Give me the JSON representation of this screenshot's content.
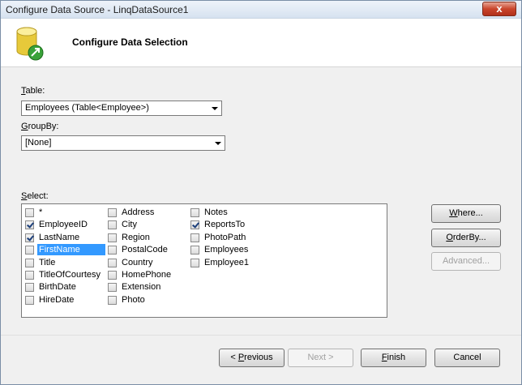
{
  "window": {
    "title": "Configure Data Source - LinqDataSource1",
    "close_label": "x"
  },
  "header": {
    "title": "Configure Data Selection",
    "icon": "database-wizard-icon"
  },
  "table": {
    "label_accel": "T",
    "label_rest": "able:",
    "value": "Employees (Table<Employee>)"
  },
  "groupby": {
    "label_accel": "G",
    "label_rest": "roupBy:",
    "value": "[None]"
  },
  "select": {
    "label_accel": "S",
    "label_rest": "elect:"
  },
  "fields": {
    "col1": [
      {
        "label": "*",
        "checked": false
      },
      {
        "label": "EmployeeID",
        "checked": true
      },
      {
        "label": "LastName",
        "checked": true
      },
      {
        "label": "FirstName",
        "checked": false,
        "selected": true
      },
      {
        "label": "Title",
        "checked": false
      },
      {
        "label": "TitleOfCourtesy",
        "checked": false
      },
      {
        "label": "BirthDate",
        "checked": false
      },
      {
        "label": "HireDate",
        "checked": false
      }
    ],
    "col2": [
      {
        "label": "Address",
        "checked": false
      },
      {
        "label": "City",
        "checked": false
      },
      {
        "label": "Region",
        "checked": false
      },
      {
        "label": "PostalCode",
        "checked": false
      },
      {
        "label": "Country",
        "checked": false
      },
      {
        "label": "HomePhone",
        "checked": false
      },
      {
        "label": "Extension",
        "checked": false
      },
      {
        "label": "Photo",
        "checked": false
      }
    ],
    "col3": [
      {
        "label": "Notes",
        "checked": false
      },
      {
        "label": "ReportsTo",
        "checked": true
      },
      {
        "label": "PhotoPath",
        "checked": false
      },
      {
        "label": "Employees",
        "checked": false
      },
      {
        "label": "Employee1",
        "checked": false
      }
    ]
  },
  "side_buttons": {
    "where_accel": "W",
    "where_rest": "here...",
    "orderby_accel": "O",
    "orderby_rest": "rderBy...",
    "advanced": "Advanced..."
  },
  "footer": {
    "previous_pre": "< ",
    "previous_accel": "P",
    "previous_rest": "revious",
    "next": "Next >",
    "finish_accel": "F",
    "finish_rest": "inish",
    "cancel": "Cancel"
  }
}
